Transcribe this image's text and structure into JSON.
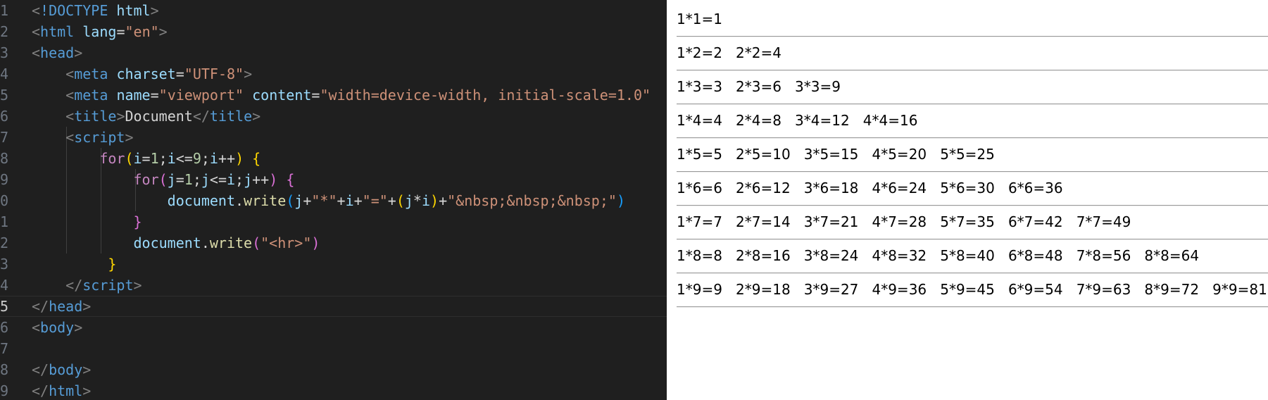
{
  "editor": {
    "lines": [
      {
        "num": "1",
        "tokens": [
          [
            "tk-punct",
            "<"
          ],
          [
            "tk-doct",
            "!DOCTYPE "
          ],
          [
            "tk-attr",
            "html"
          ],
          [
            "tk-punct",
            ">"
          ]
        ]
      },
      {
        "num": "2",
        "tokens": [
          [
            "tk-punct",
            "<"
          ],
          [
            "tk-tag",
            "html "
          ],
          [
            "tk-attr",
            "lang"
          ],
          [
            "tk-text",
            "="
          ],
          [
            "tk-str",
            "\"en\""
          ],
          [
            "tk-punct",
            ">"
          ]
        ]
      },
      {
        "num": "3",
        "tokens": [
          [
            "tk-punct",
            "<"
          ],
          [
            "tk-tag",
            "head"
          ],
          [
            "tk-punct",
            ">"
          ]
        ]
      },
      {
        "num": "4",
        "tokens": [
          [
            "tk-text",
            "    "
          ],
          [
            "tk-punct",
            "<"
          ],
          [
            "tk-tag",
            "meta "
          ],
          [
            "tk-attr",
            "charset"
          ],
          [
            "tk-text",
            "="
          ],
          [
            "tk-str",
            "\"UTF-8\""
          ],
          [
            "tk-punct",
            ">"
          ]
        ]
      },
      {
        "num": "5",
        "tokens": [
          [
            "tk-text",
            "    "
          ],
          [
            "tk-punct",
            "<"
          ],
          [
            "tk-tag",
            "meta "
          ],
          [
            "tk-attr",
            "name"
          ],
          [
            "tk-text",
            "="
          ],
          [
            "tk-str",
            "\"viewport\" "
          ],
          [
            "tk-attr",
            "content"
          ],
          [
            "tk-text",
            "="
          ],
          [
            "tk-str",
            "\"width=device-width, initial-scale=1.0\""
          ]
        ]
      },
      {
        "num": "6",
        "tokens": [
          [
            "tk-text",
            "    "
          ],
          [
            "tk-punct",
            "<"
          ],
          [
            "tk-tag",
            "title"
          ],
          [
            "tk-punct",
            ">"
          ],
          [
            "tk-text",
            "Document"
          ],
          [
            "tk-punct",
            "</"
          ],
          [
            "tk-tag",
            "title"
          ],
          [
            "tk-punct",
            ">"
          ]
        ]
      },
      {
        "num": "7",
        "tokens": [
          [
            "tk-text",
            "    "
          ],
          [
            "tk-punct",
            "<"
          ],
          [
            "tk-tag",
            "script"
          ],
          [
            "tk-punct",
            ">"
          ]
        ]
      },
      {
        "num": "8",
        "tokens": [
          [
            "tk-text",
            "        "
          ],
          [
            "tk-kw",
            "for"
          ],
          [
            "tk-b1",
            "("
          ],
          [
            "tk-var",
            "i"
          ],
          [
            "tk-op",
            "="
          ],
          [
            "tk-num",
            "1"
          ],
          [
            "tk-op",
            ";"
          ],
          [
            "tk-var",
            "i"
          ],
          [
            "tk-op",
            "<="
          ],
          [
            "tk-num",
            "9"
          ],
          [
            "tk-op",
            ";"
          ],
          [
            "tk-var",
            "i"
          ],
          [
            "tk-op",
            "++"
          ],
          [
            "tk-b1",
            ")"
          ],
          [
            "tk-text",
            " "
          ],
          [
            "tk-b1",
            "{"
          ]
        ]
      },
      {
        "num": "9",
        "tokens": [
          [
            "tk-text",
            "            "
          ],
          [
            "tk-kw",
            "for"
          ],
          [
            "tk-b2",
            "("
          ],
          [
            "tk-var",
            "j"
          ],
          [
            "tk-op",
            "="
          ],
          [
            "tk-num",
            "1"
          ],
          [
            "tk-op",
            ";"
          ],
          [
            "tk-var",
            "j"
          ],
          [
            "tk-op",
            "<="
          ],
          [
            "tk-var",
            "i"
          ],
          [
            "tk-op",
            ";"
          ],
          [
            "tk-var",
            "j"
          ],
          [
            "tk-op",
            "++"
          ],
          [
            "tk-b2",
            ")"
          ],
          [
            "tk-text",
            " "
          ],
          [
            "tk-b2",
            "{"
          ]
        ]
      },
      {
        "num": "0",
        "tokens": [
          [
            "tk-text",
            "                "
          ],
          [
            "tk-var",
            "document"
          ],
          [
            "tk-op",
            "."
          ],
          [
            "tk-fn",
            "write"
          ],
          [
            "tk-b3",
            "("
          ],
          [
            "tk-var",
            "j"
          ],
          [
            "tk-op",
            "+"
          ],
          [
            "tk-str",
            "\"*\""
          ],
          [
            "tk-op",
            "+"
          ],
          [
            "tk-var",
            "i"
          ],
          [
            "tk-op",
            "+"
          ],
          [
            "tk-str",
            "\"=\""
          ],
          [
            "tk-op",
            "+"
          ],
          [
            "tk-b1",
            "("
          ],
          [
            "tk-var",
            "j"
          ],
          [
            "tk-op",
            "*"
          ],
          [
            "tk-var",
            "i"
          ],
          [
            "tk-b1",
            ")"
          ],
          [
            "tk-op",
            "+"
          ],
          [
            "tk-str",
            "\"&nbsp;&nbsp;&nbsp;\""
          ],
          [
            "tk-b3",
            ")"
          ]
        ]
      },
      {
        "num": "1",
        "tokens": [
          [
            "tk-text",
            "            "
          ],
          [
            "tk-b2",
            "}"
          ]
        ]
      },
      {
        "num": "2",
        "tokens": [
          [
            "tk-text",
            "            "
          ],
          [
            "tk-var",
            "document"
          ],
          [
            "tk-op",
            "."
          ],
          [
            "tk-fn",
            "write"
          ],
          [
            "tk-b2",
            "("
          ],
          [
            "tk-str",
            "\"<hr>\""
          ],
          [
            "tk-b2",
            ")"
          ]
        ]
      },
      {
        "num": "3",
        "tokens": [
          [
            "tk-text",
            "         "
          ],
          [
            "tk-b1",
            "}"
          ]
        ]
      },
      {
        "num": "4",
        "tokens": [
          [
            "tk-text",
            "    "
          ],
          [
            "tk-punct",
            "</"
          ],
          [
            "tk-tag",
            "script"
          ],
          [
            "tk-punct",
            ">"
          ]
        ]
      },
      {
        "num": "5",
        "tokens": [
          [
            "tk-punct",
            "</"
          ],
          [
            "tk-tag",
            "head"
          ],
          [
            "tk-punct",
            ">"
          ]
        ],
        "current": true
      },
      {
        "num": "6",
        "tokens": [
          [
            "tk-punct",
            "<"
          ],
          [
            "tk-tag",
            "body"
          ],
          [
            "tk-punct",
            ">"
          ]
        ]
      },
      {
        "num": "7",
        "tokens": []
      },
      {
        "num": "8",
        "tokens": [
          [
            "tk-punct",
            "</"
          ],
          [
            "tk-tag",
            "body"
          ],
          [
            "tk-punct",
            ">"
          ]
        ]
      },
      {
        "num": "9",
        "tokens": [
          [
            "tk-punct",
            "</"
          ],
          [
            "tk-tag",
            "html"
          ],
          [
            "tk-punct",
            ">"
          ]
        ]
      }
    ]
  },
  "output": {
    "rows": [
      [
        "1*1=1"
      ],
      [
        "1*2=2",
        "2*2=4"
      ],
      [
        "1*3=3",
        "2*3=6",
        "3*3=9"
      ],
      [
        "1*4=4",
        "2*4=8",
        "3*4=12",
        "4*4=16"
      ],
      [
        "1*5=5",
        "2*5=10",
        "3*5=15",
        "4*5=20",
        "5*5=25"
      ],
      [
        "1*6=6",
        "2*6=12",
        "3*6=18",
        "4*6=24",
        "5*6=30",
        "6*6=36"
      ],
      [
        "1*7=7",
        "2*7=14",
        "3*7=21",
        "4*7=28",
        "5*7=35",
        "6*7=42",
        "7*7=49"
      ],
      [
        "1*8=8",
        "2*8=16",
        "3*8=24",
        "4*8=32",
        "5*8=40",
        "6*8=48",
        "7*8=56",
        "8*8=64"
      ],
      [
        "1*9=9",
        "2*9=18",
        "3*9=27",
        "4*9=36",
        "5*9=45",
        "6*9=54",
        "7*9=63",
        "8*9=72",
        "9*9=81"
      ]
    ]
  }
}
